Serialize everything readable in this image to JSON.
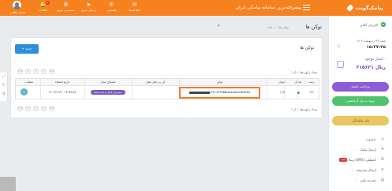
{
  "topbar": {
    "user_name": "محمد نظامی",
    "items": [
      {
        "label": "اعلانات",
        "icon": "bell-icon",
        "glyph": "🔔",
        "badge": "۵"
      },
      {
        "label": "دسترسی سریع",
        "icon": "grid-icon",
        "glyph": "⚙"
      },
      {
        "label": "ارسال سریع",
        "icon": "send-icon",
        "glyph": "➤"
      },
      {
        "label": "پشتیبانی",
        "icon": "phone-icon",
        "glyph": "✆"
      },
      {
        "label": "اطلاعیه‌ها",
        "icon": "megaphone-icon",
        "glyph": "✉"
      }
    ],
    "title": "پیشرفته‌ترین سامانه پیامکی ایران",
    "logo_text": "پیامک‌گونت"
  },
  "sidebar": {
    "online_label": "کاربران آنلاین",
    "date": "شنبه ۲۳ اردیبهشت ۱۴۰۳",
    "time": "۱۵:۳۷:۴۵",
    "credit_label": "اعتبار موجود :",
    "credit_value": "۲۱۵۶۲۱ ریال",
    "buy_credit_button": "پرداخت اعتبار",
    "connect_panel_button": "پیوند به پنل آزمایشی",
    "store_button": "پنل نمایندگی",
    "menu": [
      {
        "label": "داشبورد",
        "icon": "home-icon"
      },
      {
        "label": "ارسال پیامک",
        "icon": "send-icon"
      },
      {
        "label": "ارسال SMS (تعطیلی)",
        "icon": "message-icon",
        "badge": "جدید"
      },
      {
        "label": "ارسال پیشرفته",
        "icon": "rocket-icon"
      },
      {
        "label": "دفترچه تلفن",
        "icon": "book-icon"
      }
    ]
  },
  "page": {
    "title": "توکن ها",
    "breadcrumb": [
      "خانه",
      "توکن ها"
    ]
  },
  "card": {
    "title": "توکن ها",
    "new_button": "+ جدید",
    "record_info": "تعداد رکوردها: ۱ از ۱",
    "pager": [
      "<<",
      "<",
      "1",
      ">",
      ">>"
    ],
    "columns": [
      "ردیف",
      "شامل",
      "عنوان",
      "توکن",
      "آی پی های مجاز",
      "متدهای مجاز",
      "تاریخ انقضاء",
      "عملیات"
    ],
    "rows": [
      {
        "index": "۱۷۶",
        "title": "(۱۷)",
        "token_suffix": "E7۲۱۳۲۳۹۵B۷۸۵۸AA۸D۸D۴EEA",
        "allowed_ips": "",
        "allowed_methods": "دسترسی کامل به همه متدها",
        "expire_date": "۱۴۰۳/۱۲/۳۰ ۲۳:۵۹:۵۹",
        "action": "✎"
      }
    ]
  }
}
